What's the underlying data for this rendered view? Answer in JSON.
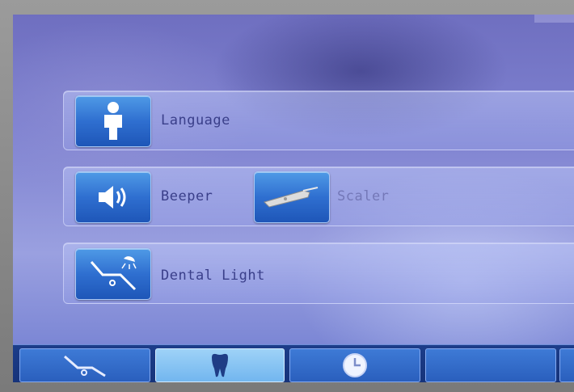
{
  "settings_menu": {
    "items": [
      {
        "label": "Language",
        "icon": "person-icon"
      },
      {
        "label": "Beeper",
        "icon": "speaker-icon"
      },
      {
        "label": "Scaler",
        "icon": "scaler-handpiece-icon"
      },
      {
        "label": "Dental Light",
        "icon": "dental-chair-light-icon"
      }
    ]
  },
  "bottom_tabs": [
    {
      "icon": "dental-chair-icon",
      "active": false
    },
    {
      "icon": "tooth-icon",
      "active": true
    },
    {
      "icon": "clock-icon",
      "active": false
    },
    {
      "icon": "blank-tab",
      "active": false
    }
  ],
  "colors": {
    "screen_blue": "#7d80cf",
    "button_blue": "#2f6fd0",
    "active_tab": "#9ed2f7",
    "label_text": "#3a3f8a"
  }
}
